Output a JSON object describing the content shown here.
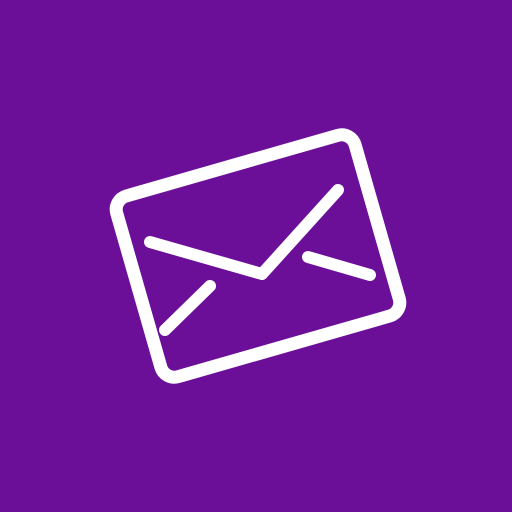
{
  "icon": {
    "name": "envelope-icon",
    "background_color": "#6b0f99",
    "stroke_color": "#ffffff"
  }
}
